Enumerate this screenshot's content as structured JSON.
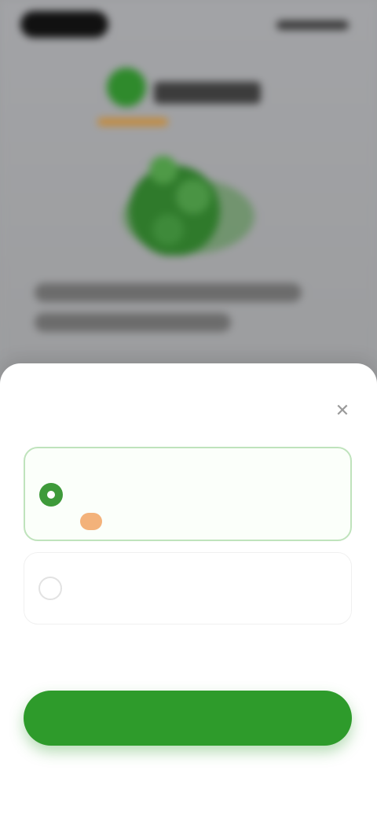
{
  "sheet": {
    "title": "",
    "close_icon": "close-icon",
    "options": [
      {
        "label": "",
        "price": "",
        "badge": "",
        "selected": true
      },
      {
        "label": "",
        "price": "",
        "sub": "",
        "selected": false
      }
    ],
    "disclaimer": "",
    "cta_label": "",
    "secondary_link": ""
  },
  "colors": {
    "accent": "#2e9b2b",
    "badge": "#f3b27a",
    "selected_border": "#bfe3bc"
  }
}
